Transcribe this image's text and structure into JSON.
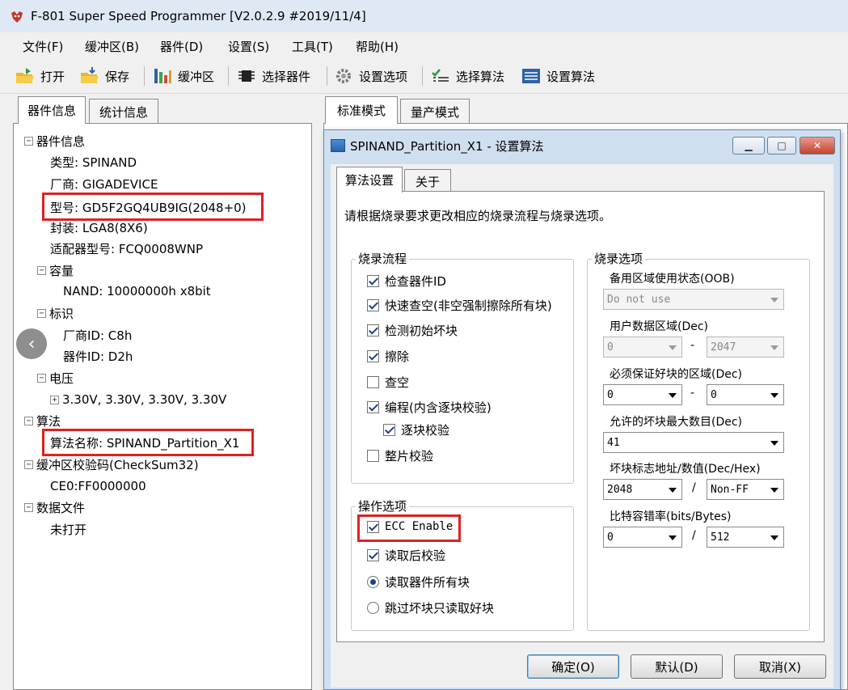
{
  "window": {
    "title": "F-801 Super Speed Programmer  [V2.0.2.9 #2019/11/4]",
    "icon": "app-logo-icon"
  },
  "menu": [
    "文件(F)",
    "缓冲区(B)",
    "器件(D)",
    "设置(S)",
    "工具(T)",
    "帮助(H)"
  ],
  "toolbar": {
    "open": "打开",
    "save": "保存",
    "buffer": "缓冲区",
    "select_device": "选择器件",
    "set_options": "设置选项",
    "select_algorithm": "选择算法",
    "set_algorithm": "设置算法"
  },
  "left_tabs": [
    "器件信息",
    "统计信息"
  ],
  "tree": {
    "device_info": "器件信息",
    "type": "类型: SPINAND",
    "vendor": "厂商: GIGADEVICE",
    "model": "型号: GD5F2GQ4UB9IG(2048+0)",
    "package": "封装: LGA8(8X6)",
    "adapter": "适配器型号: FCQ0008WNP",
    "capacity": "容量",
    "nand": "NAND: 10000000h x8bit",
    "ident": "标识",
    "vendor_id": "厂商ID: C8h",
    "device_id": "器件ID: D2h",
    "voltage": "电压",
    "voltage_values": "3.30V, 3.30V, 3.30V, 3.30V",
    "algorithm": "算法",
    "algorithm_name": "算法名称: SPINAND_Partition_X1",
    "checksum": "缓冲区校验码(CheckSum32)",
    "checksum_value": "CE0:FF0000000",
    "data_file": "数据文件",
    "data_file_value": "未打开"
  },
  "right_tabs": [
    "标准模式",
    "量产模式"
  ],
  "dialog": {
    "title": "SPINAND_Partition_X1 - 设置算法",
    "tabs": [
      "算法设置",
      "关于"
    ],
    "instruction": "请根据烧录要求更改相应的烧录流程与烧录选项。",
    "flow": {
      "title": "烧录流程",
      "items": [
        {
          "label": "检查器件ID",
          "checked": true
        },
        {
          "label": "快速查空(非空强制擦除所有块)",
          "checked": true
        },
        {
          "label": "检测初始坏块",
          "checked": true
        },
        {
          "label": "擦除",
          "checked": true
        },
        {
          "label": "查空",
          "checked": false
        },
        {
          "label": "编程(内含逐块校验)",
          "checked": true
        },
        {
          "label": "逐块校验",
          "checked": true
        },
        {
          "label": "整片校验",
          "checked": false
        }
      ]
    },
    "ops": {
      "title": "操作选项",
      "ecc": "ECC Enable",
      "ecc_checked": true,
      "verify_after_read": "读取后校验",
      "verify_checked": true,
      "read_all": "读取器件所有块",
      "read_all_selected": true,
      "skip_bad": "跳过坏块只读取好块",
      "skip_bad_selected": false
    },
    "options": {
      "title": "烧录选项",
      "spare_label": "备用区域使用状态(OOB)",
      "spare_value": "Do not use",
      "user_area_label": "用户数据区域(Dec)",
      "user_area_from": "0",
      "user_area_to": "2047",
      "good_block_label": "必须保证好块的区域(Dec)",
      "good_block_from": "0",
      "good_block_to": "0",
      "max_bad_label": "允许的坏块最大数目(Dec)",
      "max_bad_value": "41",
      "bad_mark_label": "坏块标志地址/数值(Dec/Hex)",
      "bad_mark_addr": "2048",
      "bad_mark_value": "Non-FF",
      "bitflip_label": "比特容错率(bits/Bytes)",
      "bitflip_bits": "0",
      "bitflip_bytes": "512",
      "dash": "-",
      "slash": "/"
    },
    "buttons": {
      "ok": "确定(O)",
      "default": "默认(D)",
      "cancel": "取消(X)"
    }
  },
  "colors": {
    "highlight": "#e02020",
    "titlebar": "#dfe9f5",
    "dialog_frame": "#cfdff0"
  }
}
